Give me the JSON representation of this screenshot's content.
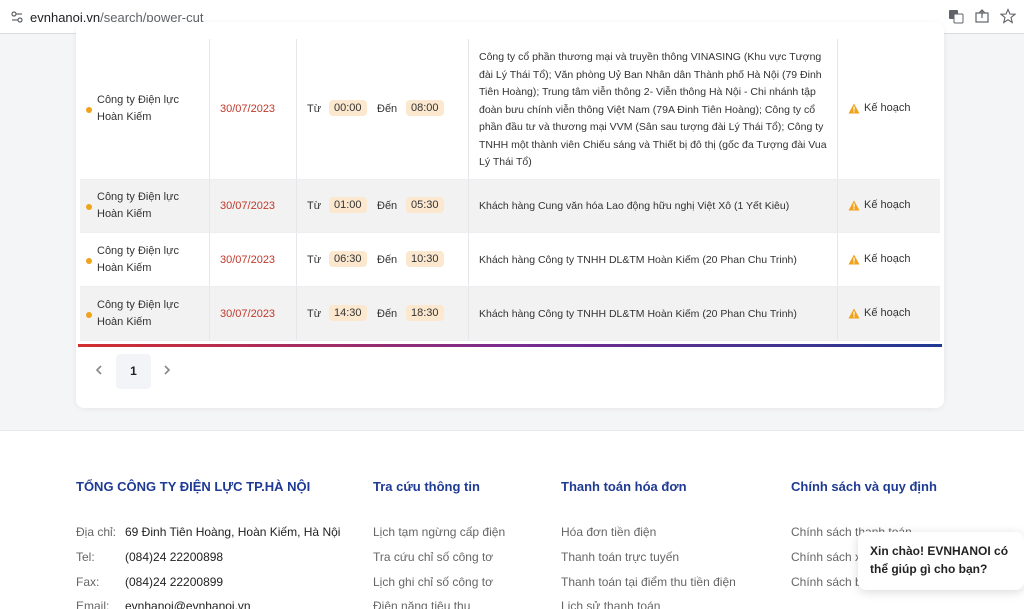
{
  "browser": {
    "url_domain": "evnhanoi.vn",
    "url_path": "/search/power-cut"
  },
  "table": {
    "rows": [
      {
        "unit": "Công ty Điện lực Hoàn Kiếm",
        "date": "30/07/2023",
        "from_label": "Từ",
        "from_time": "00:00",
        "to_label": "Đến",
        "to_time": "08:00",
        "desc": "Công ty cổ phần thương mại và truyền thông VINASING (Khu vực Tượng đài Lý Thái Tổ); Văn phòng Uỷ Ban Nhân dân Thành phố Hà Nội (79 Đinh Tiên Hoàng); Trung tâm viễn thông 2- Viễn thông Hà Nội - Chi nhánh tập đoàn bưu chính viễn thông Việt Nam (79A Đinh Tiên Hoàng); Công ty cổ phần đầu tư và thương mại VVM (Sân sau tượng đài Lý Thái Tổ); Công ty TNHH một thành viên Chiếu sáng và Thiết bị đô thị (gốc đa Tượng đài Vua Lý Thái Tổ)",
        "status": "Kế hoạch"
      },
      {
        "unit": "Công ty Điện lực Hoàn Kiếm",
        "date": "30/07/2023",
        "from_label": "Từ",
        "from_time": "01:00",
        "to_label": "Đến",
        "to_time": "05:30",
        "desc": "Khách hàng Cung văn hóa Lao động hữu nghị Việt Xô (1 Yết Kiêu)",
        "status": "Kế hoạch"
      },
      {
        "unit": "Công ty Điện lực Hoàn Kiếm",
        "date": "30/07/2023",
        "from_label": "Từ",
        "from_time": "06:30",
        "to_label": "Đến",
        "to_time": "10:30",
        "desc": "Khách hàng Công ty TNHH DL&TM Hoàn Kiếm (20 Phan Chu Trinh)",
        "status": "Kế hoạch"
      },
      {
        "unit": "Công ty Điện lực Hoàn Kiếm",
        "date": "30/07/2023",
        "from_label": "Từ",
        "from_time": "14:30",
        "to_label": "Đến",
        "to_time": "18:30",
        "desc": "Khách hàng Công ty TNHH DL&TM Hoàn Kiếm (20 Phan Chu Trinh)",
        "status": "Kế hoạch"
      }
    ]
  },
  "pagination": {
    "current": "1"
  },
  "footer": {
    "company": "TỔNG CÔNG TY ĐIỆN LỰC TP.HÀ NỘI",
    "address_label": "Địa chỉ:",
    "address": "69 Đinh Tiên Hoàng, Hoàn Kiếm, Hà Nội",
    "tel_label": "Tel:",
    "tel": "(084)24 22200898",
    "fax_label": "Fax:",
    "fax": "(084)24 22200899",
    "email_label": "Email:",
    "email": "evnhanoi@evnhanoi.vn",
    "col2_title": "Tra cứu thông tin",
    "col2_links": [
      "Lịch tạm ngừng cấp điện",
      "Tra cứu chỉ số công tơ",
      "Lịch ghi chỉ số công tơ",
      "Điện năng tiêu thụ"
    ],
    "col3_title": "Thanh toán hóa đơn",
    "col3_links": [
      "Hóa đơn tiền điện",
      "Thanh toán trực tuyến",
      "Thanh toán tại điểm thu tiền điện",
      "Lịch sử thanh toán"
    ],
    "col4_title": "Chính sách và quy định",
    "col4_links": [
      "Chính sách thanh toán",
      "Chính sách x",
      "Chính sách b"
    ]
  },
  "chat": {
    "message": "Xin chào! EVNHANOI có thể giúp gì cho bạn?"
  },
  "colors": {
    "accent": "#1f3a93",
    "date": "#c0392b",
    "dot": "#f0a21b",
    "time_bg": "#fbe8cf"
  }
}
